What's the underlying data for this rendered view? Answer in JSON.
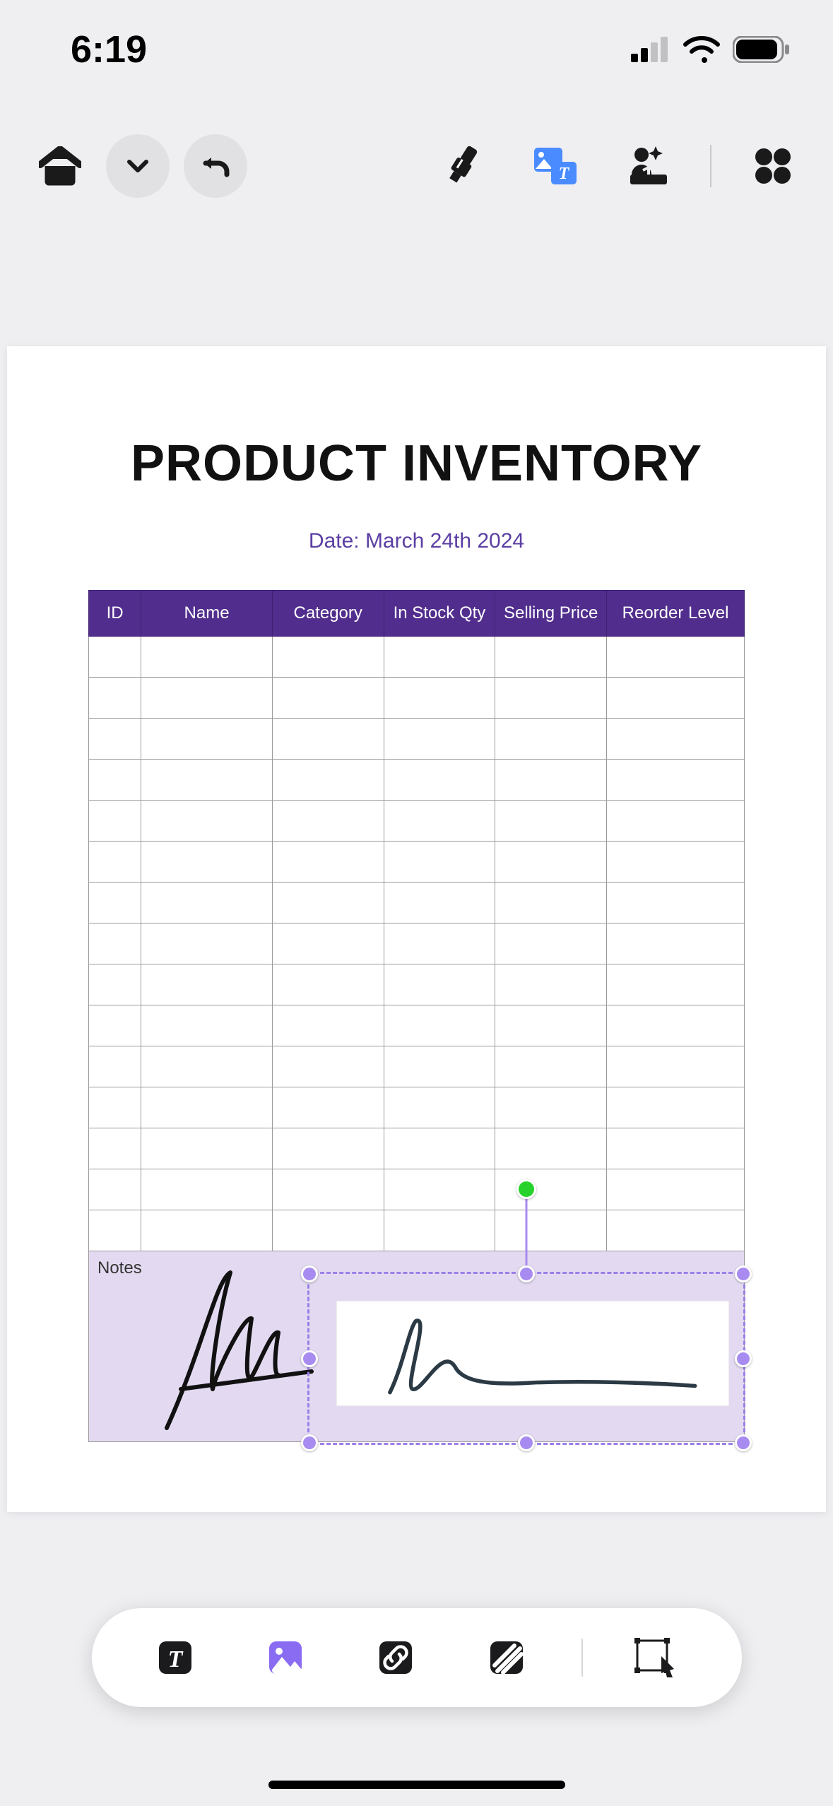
{
  "status_bar": {
    "time": "6:19"
  },
  "top_toolbar": {
    "home": "home",
    "dropdown": "chevron-down",
    "undo": "undo",
    "highlighter": "highlighter",
    "image_text": "image-text",
    "ai_image": "ai-insert",
    "apps": "grid-apps"
  },
  "document": {
    "title": "PRODUCT INVENTORY",
    "date_line": "Date: March 24th 2024",
    "columns": [
      "ID",
      "Name",
      "Category",
      "In Stock Qty",
      "Selling Price",
      "Reorder Level"
    ],
    "rows": [
      [
        "",
        "",
        "",
        "",
        "",
        ""
      ],
      [
        "",
        "",
        "",
        "",
        "",
        ""
      ],
      [
        "",
        "",
        "",
        "",
        "",
        ""
      ],
      [
        "",
        "",
        "",
        "",
        "",
        ""
      ],
      [
        "",
        "",
        "",
        "",
        "",
        ""
      ],
      [
        "",
        "",
        "",
        "",
        "",
        ""
      ],
      [
        "",
        "",
        "",
        "",
        "",
        ""
      ],
      [
        "",
        "",
        "",
        "",
        "",
        ""
      ],
      [
        "",
        "",
        "",
        "",
        "",
        ""
      ],
      [
        "",
        "",
        "",
        "",
        "",
        ""
      ],
      [
        "",
        "",
        "",
        "",
        "",
        ""
      ],
      [
        "",
        "",
        "",
        "",
        "",
        ""
      ],
      [
        "",
        "",
        "",
        "",
        "",
        ""
      ],
      [
        "",
        "",
        "",
        "",
        "",
        ""
      ],
      [
        "",
        "",
        "",
        "",
        "",
        ""
      ]
    ],
    "notes_label": "Notes"
  },
  "bottom_toolbar": {
    "text": "text-tool",
    "image": "image-tool",
    "link": "link-tool",
    "pattern": "pattern-tool",
    "transform": "transform-tool"
  }
}
